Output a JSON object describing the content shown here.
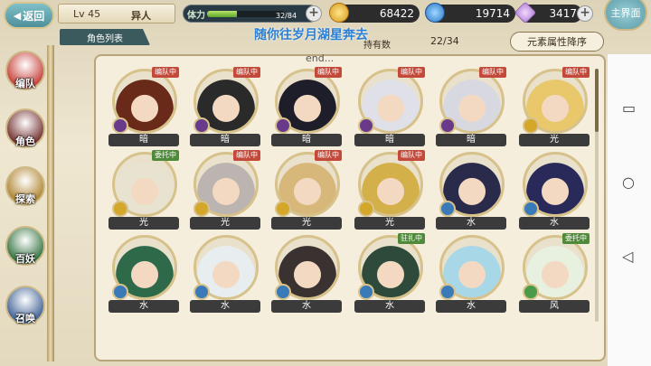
{
  "topbar": {
    "back_label": "返回",
    "level": "Lv 45",
    "player_name": "异人",
    "stamina_label": "体力",
    "stamina_text": "32/84",
    "stamina_fraction": 0.38,
    "gold": "68422",
    "gems": "19714",
    "crystals": "3417",
    "main_label": "主界面"
  },
  "subheader": {
    "list_tab": "角色列表",
    "owned_label": "持有数",
    "owned_value": "22/34",
    "sort_label": "元素属性降序"
  },
  "overlay": {
    "caption": "随你往岁月湖星奔去",
    "end_text": "end..."
  },
  "nav": [
    {
      "label": "编队",
      "color": "#c84a44"
    },
    {
      "label": "角色",
      "color": "#7a3a3a"
    },
    {
      "label": "探索",
      "color": "#b38a3a"
    },
    {
      "label": "百妖",
      "color": "#3e7a4a"
    },
    {
      "label": "召唤",
      "color": "#4a6a9a"
    }
  ],
  "tags": {
    "red": "编队中",
    "green_delegate": "委托中",
    "green_stationed": "驻扎中"
  },
  "cards": [
    {
      "element": "暗",
      "tag": "编队中",
      "tag_color": "red",
      "hair": "#6a2a1a",
      "elem_color": "#6a3a8a"
    },
    {
      "element": "暗",
      "tag": "编队中",
      "tag_color": "red",
      "hair": "#2a2a2a",
      "elem_color": "#6a3a8a"
    },
    {
      "element": "暗",
      "tag": "编队中",
      "tag_color": "red",
      "hair": "#1e1e2a",
      "elem_color": "#6a3a8a"
    },
    {
      "element": "暗",
      "tag": "编队中",
      "tag_color": "red",
      "hair": "#e0e0e8",
      "elem_color": "#6a3a8a"
    },
    {
      "element": "暗",
      "tag": "编队中",
      "tag_color": "red",
      "hair": "#d8d8e0",
      "elem_color": "#6a3a8a"
    },
    {
      "element": "光",
      "tag": "编队中",
      "tag_color": "red",
      "hair": "#e8c86a",
      "elem_color": "#d4a62a"
    },
    {
      "element": "光",
      "tag": "委托中",
      "tag_color": "green",
      "hair": "#e8e2d0",
      "elem_color": "#d4a62a"
    },
    {
      "element": "光",
      "tag": "编队中",
      "tag_color": "red",
      "hair": "#bcb4b0",
      "elem_color": "#d4a62a"
    },
    {
      "element": "光",
      "tag": "编队中",
      "tag_color": "red",
      "hair": "#d8b87a",
      "elem_color": "#d4a62a"
    },
    {
      "element": "光",
      "tag": "编队中",
      "tag_color": "red",
      "hair": "#d4b04a",
      "elem_color": "#d4a62a"
    },
    {
      "element": "水",
      "tag": "",
      "tag_color": "",
      "hair": "#2a2a4a",
      "elem_color": "#3a7ab8"
    },
    {
      "element": "水",
      "tag": "",
      "tag_color": "",
      "hair": "#2a2a5a",
      "elem_color": "#3a7ab8"
    },
    {
      "element": "水",
      "tag": "",
      "tag_color": "",
      "hair": "#2e6a4a",
      "elem_color": "#3a7ab8"
    },
    {
      "element": "水",
      "tag": "",
      "tag_color": "",
      "hair": "#e8eef0",
      "elem_color": "#3a7ab8"
    },
    {
      "element": "水",
      "tag": "",
      "tag_color": "",
      "hair": "#3a3230",
      "elem_color": "#3a7ab8"
    },
    {
      "element": "水",
      "tag": "驻扎中",
      "tag_color": "green",
      "hair": "#2e4a3a",
      "elem_color": "#3a7ab8"
    },
    {
      "element": "水",
      "tag": "",
      "tag_color": "",
      "hair": "#a8d8e8",
      "elem_color": "#3a7ab8"
    },
    {
      "element": "风",
      "tag": "委托中",
      "tag_color": "green",
      "hair": "#e8f0e0",
      "elem_color": "#4a9a4a"
    }
  ],
  "sysnav": [
    "▭",
    "○",
    "◁"
  ]
}
